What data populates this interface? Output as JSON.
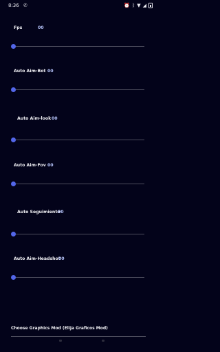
{
  "status_bar": {
    "time": "8:36",
    "notification_icon": "phone-icon",
    "icons": [
      "alarm-icon",
      "bluetooth-icon",
      "wifi-icon",
      "signal-icon",
      "battery-icon"
    ]
  },
  "settings": [
    {
      "label": "Fps",
      "value": "00",
      "slider_fraction": 0
    },
    {
      "label": "Auto Aim-Bot",
      "value": "00",
      "slider_fraction": 0
    },
    {
      "label": "Auto Aim-look",
      "value": "00",
      "slider_fraction": 0
    },
    {
      "label": "Auto Aim-Fov",
      "value": "00",
      "slider_fraction": 0
    },
    {
      "label": "Auto Seguimiento",
      "value": "00",
      "slider_fraction": 0
    },
    {
      "label": "Auto Aim-Headshot",
      "value": "00",
      "slider_fraction": 0
    }
  ],
  "graphics": {
    "label": "Choose Graphics Mod (Elija Graficos Mod)"
  },
  "colors": {
    "background": "#03031a",
    "slider_thumb": "#5366e8",
    "slider_track": "#4e4e5e",
    "value_text": "#b9c7ff"
  }
}
